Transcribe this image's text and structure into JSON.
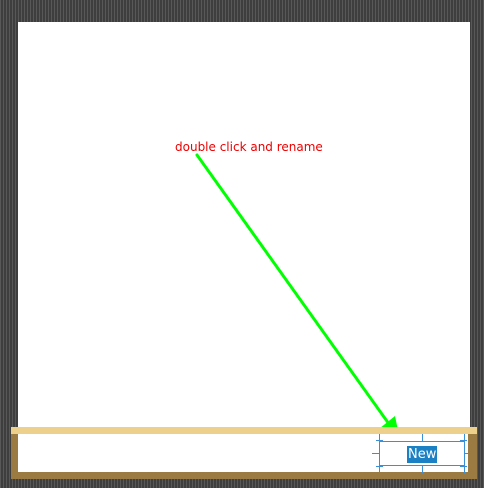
{
  "annotation": {
    "text": "double click and rename",
    "text_color": "#ee0000",
    "arrow_color": "#00ff00"
  },
  "task_bar": {
    "rename_field": {
      "value": "New",
      "selected": true,
      "selection_color": "#1b80c4"
    },
    "colors": {
      "frame": "#9c7b43",
      "top_edge": "#ecd08c"
    }
  }
}
